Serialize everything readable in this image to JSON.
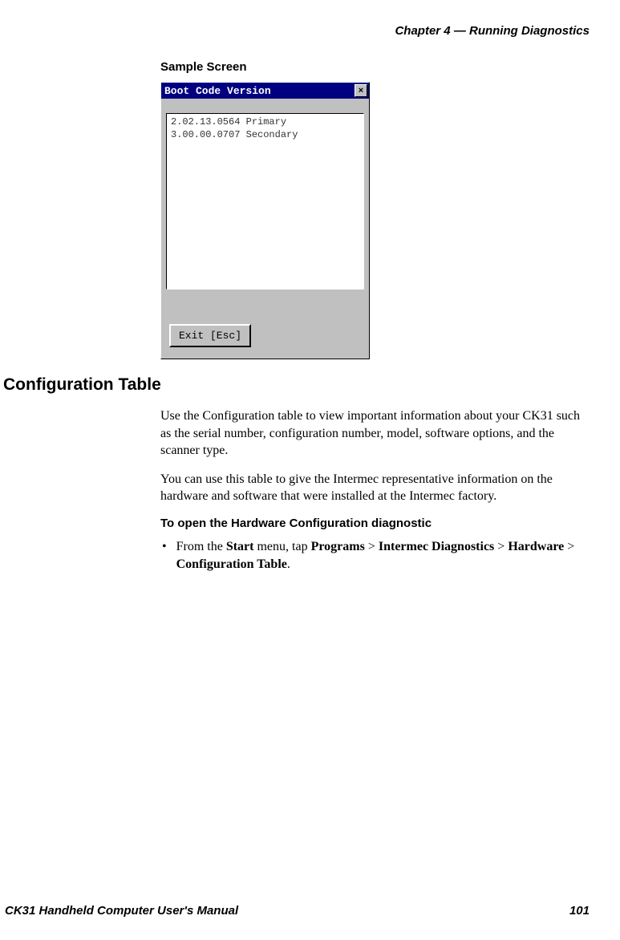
{
  "header": "Chapter 4 — Running Diagnostics",
  "sample_title": "Sample Screen",
  "screenshot": {
    "title": "Boot Code Version",
    "close_label": "×",
    "line1": "2.02.13.0564 Primary",
    "line2": "3.00.00.0707 Secondary",
    "exit_label": "Exit [Esc]"
  },
  "section_heading": "Configuration Table",
  "para1": "Use the Configuration table to view important information about your CK31 such as the serial number, configuration number, model, software options, and the scanner type.",
  "para2": "You can use this table to give the Intermec representative information on the hardware and software that were installed at the Intermec factory.",
  "sub_heading": "To open the Hardware Configuration diagnostic",
  "instruction": {
    "pre": "From the ",
    "start": "Start",
    "mid1": " menu, tap ",
    "programs": "Programs",
    "gt1": " > ",
    "diag": "Intermec Diagnostics",
    "gt2": " > ",
    "hardware": "Hardware",
    "gt3": " > ",
    "config": "Configuration Table",
    "period": "."
  },
  "footer": {
    "left": "CK31 Handheld Computer User's Manual",
    "right": "101"
  }
}
